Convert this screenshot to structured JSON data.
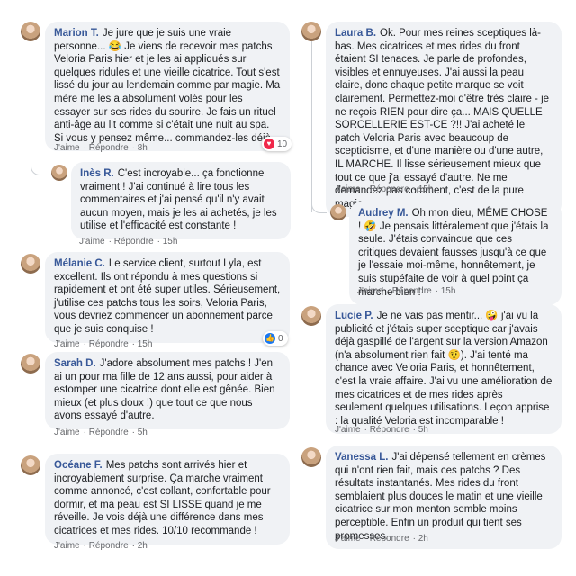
{
  "actions": {
    "like": "J'aime",
    "reply": "Répondre"
  },
  "comments": [
    {
      "name": "Marion T.",
      "text": "Je jure que je suis une vraie personne... 😂 Je viens de recevoir mes patchs Veloria Paris hier et je les ai appliqués sur quelques ridules et une vieille cicatrice. Tout s'est lissé du jour au lendemain comme par magie. Ma mère me les a absolument volés pour les essayer sur ses rides du sourire. Je fais un rituel anti-âge au lit comme si c'était une nuit au spa. Si vous y pensez même... commandez-les déjà.",
      "time": "8h",
      "reaction_count": "10",
      "reaction_icon": "heart-icon"
    },
    {
      "name": "Inès R.",
      "text": "C'est incroyable... ça fonctionne vraiment ! J'ai continué à lire tous les commentaires et j'ai pensé qu'il n'y avait aucun moyen, mais je les ai achetés, je les utilise et l'efficacité est constante !",
      "time": "15h"
    },
    {
      "name": "Mélanie C.",
      "text": "Le service client, surtout Lyla, est excellent. Ils ont répondu à mes questions si rapidement et ont été super utiles. Sérieusement, j'utilise ces patchs tous les soirs, Veloria Paris, vous devriez commencer un abonnement parce que je suis conquise !",
      "time": "15h",
      "reaction_count": "0",
      "reaction_icon": "like-icon"
    },
    {
      "name": "Sarah D.",
      "text": "J'adore absolument mes patchs ! J'en ai un pour ma fille de 12 ans aussi, pour aider à estomper une cicatrice dont elle est gênée. Bien mieux (et plus doux !) que tout ce que nous avons essayé d'autre.",
      "time": "5h"
    },
    {
      "name": "Océane F.",
      "text": "Mes patchs sont arrivés hier et incroyablement surprise. Ça marche vraiment comme annoncé, c'est collant, confortable pour dormir, et ma peau est SI LISSE quand je me réveille. Je vois déjà une différence dans mes cicatrices et mes rides. 10/10 recommande !",
      "time": "2h"
    },
    {
      "name": "Laura B.",
      "text": "Ok. Pour mes reines sceptiques là-bas. Mes cicatrices et mes rides du front étaient SI tenaces. Je parle de profondes, visibles et ennuyeuses. J'ai aussi la peau claire, donc chaque petite marque se voit clairement. Permettez-moi d'être très claire - je ne reçois RIEN pour dire ça... MAIS QUELLE SORCELLERIE EST-CE ?!! J'ai acheté le patch Veloria Paris avec beaucoup de scepticisme, et d'une manière ou d'une autre, IL MARCHE. Il lisse sérieusement mieux que tout ce que j'ai essayé d'autre. Ne me demandez pas comment, c'est de la pure magie.",
      "time": "15h"
    },
    {
      "name": "Audrey M.",
      "text": "Oh mon dieu, MÊME CHOSE ! 🤣 Je pensais littéralement que j'étais la seule. J'étais convaincue que ces critiques devaient fausses jusqu'à ce que je l'essaie moi-même, honnêtement, je suis stupéfaite de voir à quel point ça marche bien !",
      "time": "15h"
    },
    {
      "name": "Lucie P.",
      "text": "Je ne vais pas mentir... 🤪 j'ai vu la publicité et j'étais super sceptique car j'avais déjà gaspillé de l'argent sur la version Amazon (n'a absolument rien fait 🤨). J'ai tenté ma chance avec Veloria Paris, et honnêtement, c'est la vraie affaire. J'ai vu une amélioration de mes cicatrices et de mes rides après seulement quelques utilisations. Leçon apprise : la qualité Veloria est incomparable !",
      "time": "5h"
    },
    {
      "name": "Vanessa L.",
      "text": "J'ai dépensé tellement en crèmes qui n'ont rien fait, mais ces patchs ? Des résultats instantanés. Mes rides du front semblaient plus douces le matin et une vieille cicatrice sur mon menton semble moins perceptible. Enfin un produit qui tient ses promesses.",
      "time": "2h"
    }
  ]
}
